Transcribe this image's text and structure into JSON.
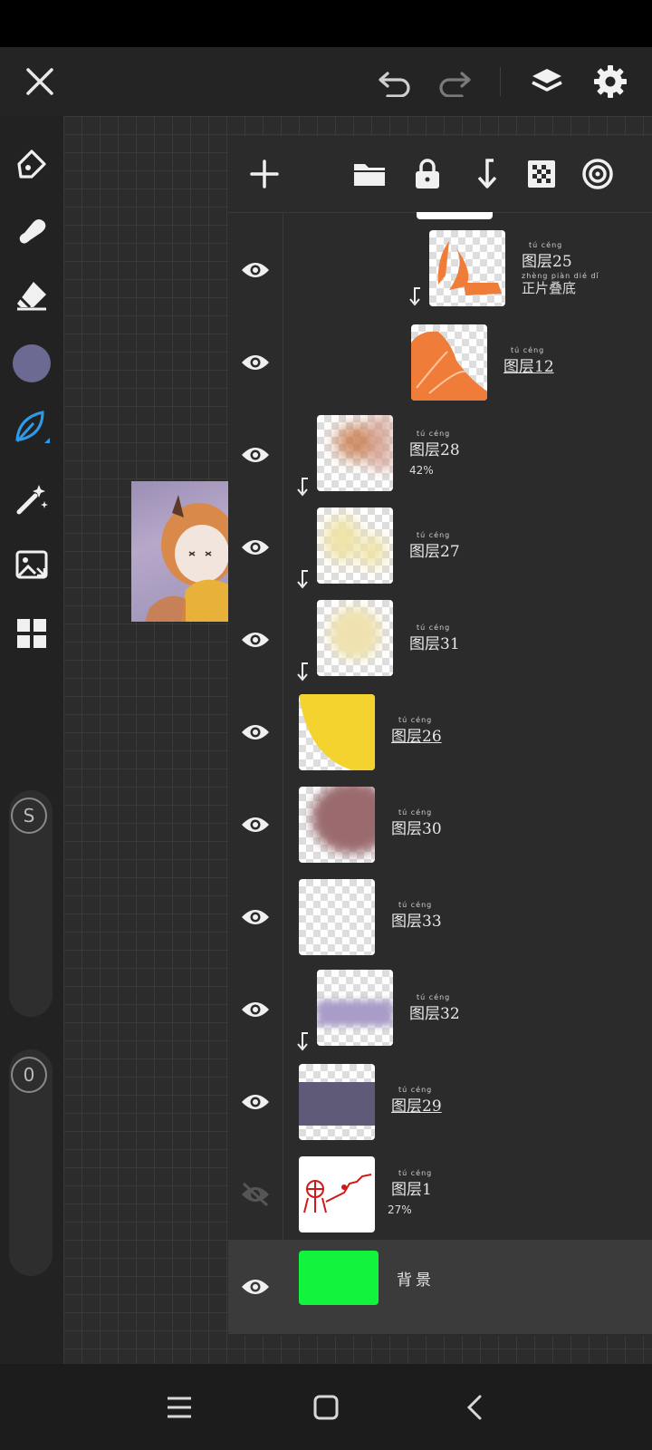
{
  "toolbar": {
    "close": "close-icon",
    "undo": "undo-icon",
    "redo": "redo-icon",
    "layers": "layers-icon",
    "settings": "gear-icon"
  },
  "tools": [
    "pen-icon",
    "smudge-icon",
    "eraser-icon",
    "color-swatch",
    "leaf-brush-icon",
    "magic-wand-icon",
    "image-import-icon",
    "gallery-grid-icon"
  ],
  "colors": {
    "brush_color": "#6c6a92",
    "accent": "#2e9be8",
    "background_green": "#11f33c"
  },
  "sliders": {
    "size_label": "S",
    "opacity_label": "0"
  },
  "layer_actions": [
    "add-layer-icon",
    "folder-icon",
    "lock-icon",
    "merge-down-icon",
    "transparency-icon",
    "blend-mode-icon"
  ],
  "layers": [
    {
      "name": "图层25",
      "ruby": "tú céng",
      "sub": "正片叠底",
      "sub_ruby": "zhèng piàn dié dǐ",
      "visible": true,
      "clipped": true,
      "indent": 1
    },
    {
      "name": "图层12",
      "ruby": "tú céng",
      "sub": "",
      "visible": true,
      "clipped": false,
      "indent": 2
    },
    {
      "name": "图层28",
      "ruby": "tú céng",
      "sub": "42%",
      "visible": true,
      "clipped": true,
      "indent": 1
    },
    {
      "name": "图层27",
      "ruby": "tú céng",
      "sub": "",
      "visible": true,
      "clipped": true,
      "indent": 1
    },
    {
      "name": "图层31",
      "ruby": "tú céng",
      "sub": "",
      "visible": true,
      "clipped": true,
      "indent": 1
    },
    {
      "name": "图层26",
      "ruby": "tú céng",
      "sub": "",
      "visible": true,
      "clipped": false,
      "indent": 0
    },
    {
      "name": "图层30",
      "ruby": "tú céng",
      "sub": "",
      "visible": true,
      "clipped": false,
      "indent": 0
    },
    {
      "name": "图层33",
      "ruby": "tú céng",
      "sub": "",
      "visible": true,
      "clipped": false,
      "indent": 0
    },
    {
      "name": "图层32",
      "ruby": "tú céng",
      "sub": "",
      "visible": true,
      "clipped": true,
      "indent": 1
    },
    {
      "name": "图层29",
      "ruby": "tú céng",
      "sub": "",
      "visible": true,
      "clipped": false,
      "indent": 0
    },
    {
      "name": "图层1",
      "ruby": "tú céng",
      "sub": "27%",
      "visible": false,
      "clipped": false,
      "indent": 0
    },
    {
      "name": "背景",
      "ruby": "",
      "sub": "",
      "visible": true,
      "clipped": false,
      "indent": 0
    }
  ],
  "nav": [
    "recent-apps-icon",
    "home-icon",
    "back-icon"
  ]
}
